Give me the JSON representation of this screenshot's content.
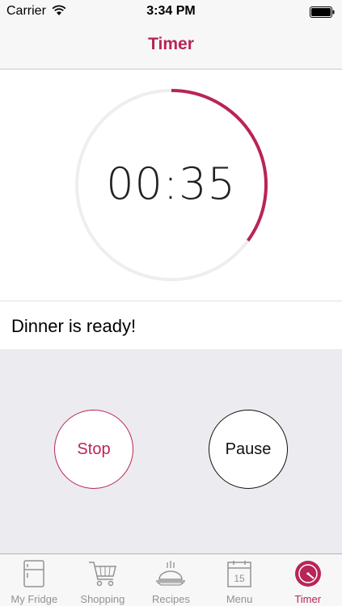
{
  "status_bar": {
    "carrier": "Carrier",
    "time": "3:34 PM"
  },
  "nav": {
    "title": "Timer"
  },
  "timer": {
    "display": "00:35",
    "progress_fraction": 0.35,
    "accent_color": "#b82558",
    "track_color": "#eeeeee"
  },
  "message": {
    "text": "Dinner is ready!"
  },
  "controls": {
    "stop_label": "Stop",
    "pause_label": "Pause"
  },
  "tabs": [
    {
      "label": "My Fridge",
      "icon": "fridge-icon"
    },
    {
      "label": "Shopping",
      "icon": "cart-icon"
    },
    {
      "label": "Recipes",
      "icon": "dish-icon"
    },
    {
      "label": "Menu",
      "icon": "calendar-icon",
      "calendar_day": "15"
    },
    {
      "label": "Timer",
      "icon": "timer-icon",
      "active": true
    }
  ],
  "colors": {
    "accent": "#b82558",
    "background_controls": "#ebebf0",
    "tab_inactive": "#929292"
  }
}
